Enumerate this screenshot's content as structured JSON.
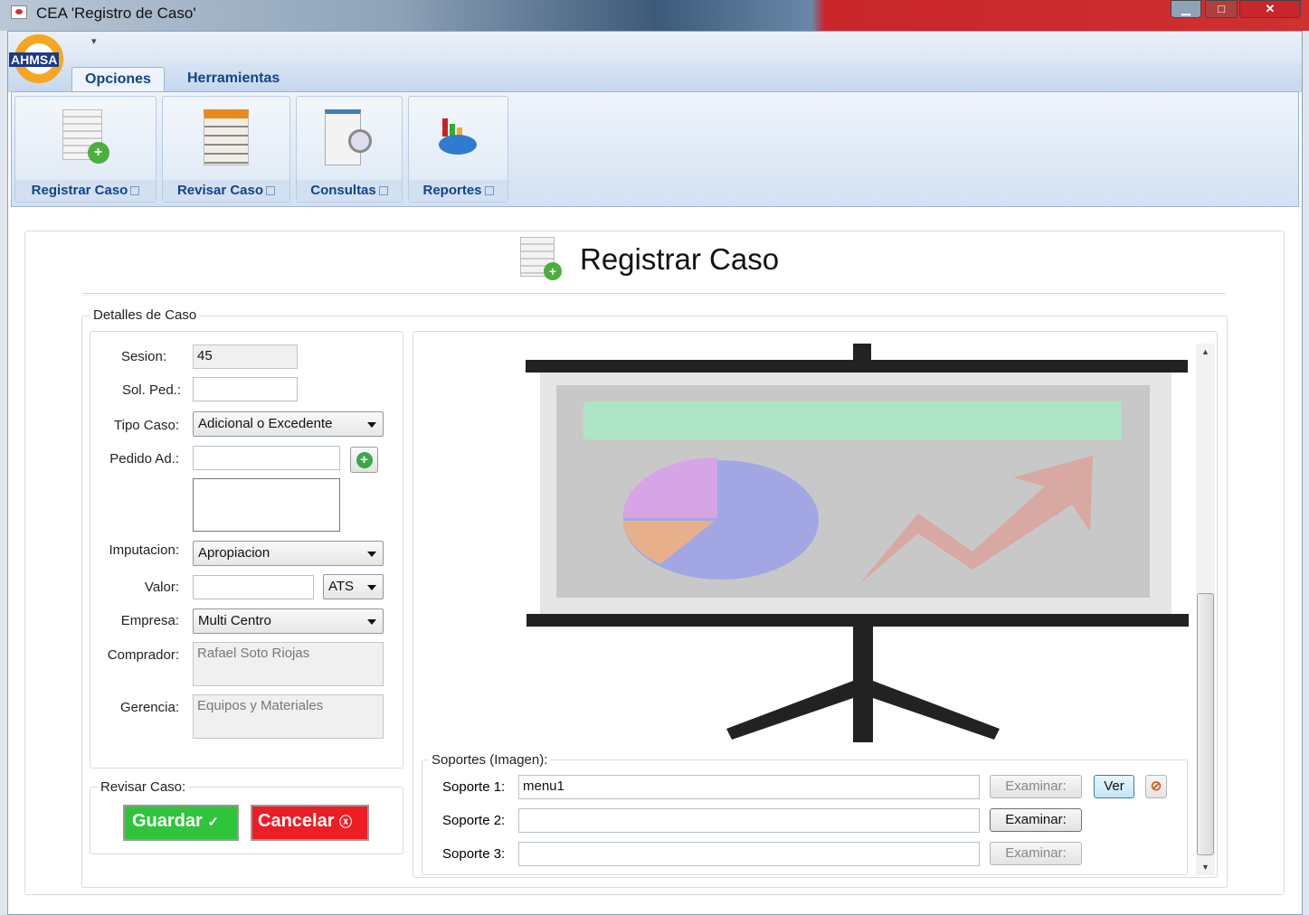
{
  "window": {
    "title": "CEA 'Registro de Caso'",
    "minimize": "▁",
    "maximize": "□",
    "close": "✕"
  },
  "logo": {
    "text": "AHMSA"
  },
  "ribbon": {
    "tabs": [
      {
        "label": "Opciones"
      },
      {
        "label": "Herramientas"
      }
    ],
    "buttons": [
      {
        "label": "Registrar Caso"
      },
      {
        "label": "Revisar Caso"
      },
      {
        "label": "Consultas"
      },
      {
        "label": "Reportes"
      }
    ]
  },
  "page": {
    "title": "Registrar Caso"
  },
  "detalles": {
    "legend": "Detalles de Caso",
    "sesion_label": "Sesion:",
    "sesion": "45",
    "solped_label": "Sol. Ped.:",
    "solped": "",
    "tipo_label": "Tipo Caso:",
    "tipo": "Adicional o Excedente",
    "pedido_label": "Pedido Ad.:",
    "pedido": "",
    "imputacion_label": "Imputacion:",
    "imputacion": "Apropiacion",
    "valor_label": "Valor:",
    "valor": "",
    "moneda": "ATS",
    "empresa_label": "Empresa:",
    "empresa": "Multi Centro",
    "comprador_label": "Comprador:",
    "comprador": "Rafael Soto Riojas",
    "gerencia_label": "Gerencia:",
    "gerencia": "Equipos y Materiales"
  },
  "revisar": {
    "legend": "Revisar Caso:",
    "guardar": "Guardar",
    "cancelar": "Cancelar"
  },
  "soportes": {
    "legend": "Soportes (Imagen):",
    "rows": [
      {
        "label": "Soporte 1:",
        "value": "menu1",
        "browse": "Examinar:"
      },
      {
        "label": "Soporte 2:",
        "value": "",
        "browse": "Examinar:"
      },
      {
        "label": "Soporte 3:",
        "value": "",
        "browse": "Examinar:"
      }
    ],
    "ver": "Ver"
  }
}
